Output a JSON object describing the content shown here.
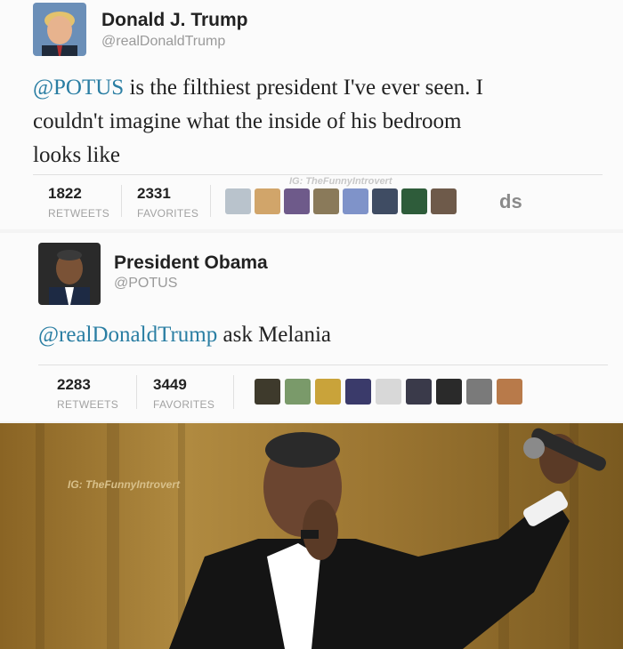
{
  "tweet1": {
    "name": "Donald J. Trump",
    "handle": "@realDonaldTrump",
    "text_mention": "@POTUS",
    "text_line1_rest": " is the filthiest president I've ever seen. I",
    "text_line2": "couldn't imagine what the inside of his bedroom",
    "text_line3": "looks like",
    "retweets": "1822",
    "retweets_label": "RETWEETS",
    "favorites": "2331",
    "favorites_label": "FAVORITES",
    "watermark": "IG: TheFunnyIntrovert",
    "fav_colors": [
      "#b9c3cc",
      "#d1a56a",
      "#6e5a8a",
      "#8a7a5a",
      "#7f93c9",
      "#3f4c63",
      "#2e5c3a",
      "#6e5a4a"
    ],
    "trailing_text": "ds"
  },
  "tweet2": {
    "name": "President Obama",
    "handle": "@POTUS",
    "text_mention": "@realDonaldTrump",
    "text_rest": " ask Melania",
    "retweets": "2283",
    "retweets_label": "RETWEETS",
    "favorites": "3449",
    "favorites_label": "FAVORITES",
    "fav_colors": [
      "#3e3a2c",
      "#7a9a6a",
      "#c9a33a",
      "#3a3a6a",
      "#d8d8d8",
      "#3a3a4a",
      "#2a2a2a",
      "#7a7a7a",
      "#b87a4a"
    ]
  },
  "photo": {
    "watermark": "IG: TheFunnyIntrovert",
    "bg_color": "#a07a32"
  }
}
